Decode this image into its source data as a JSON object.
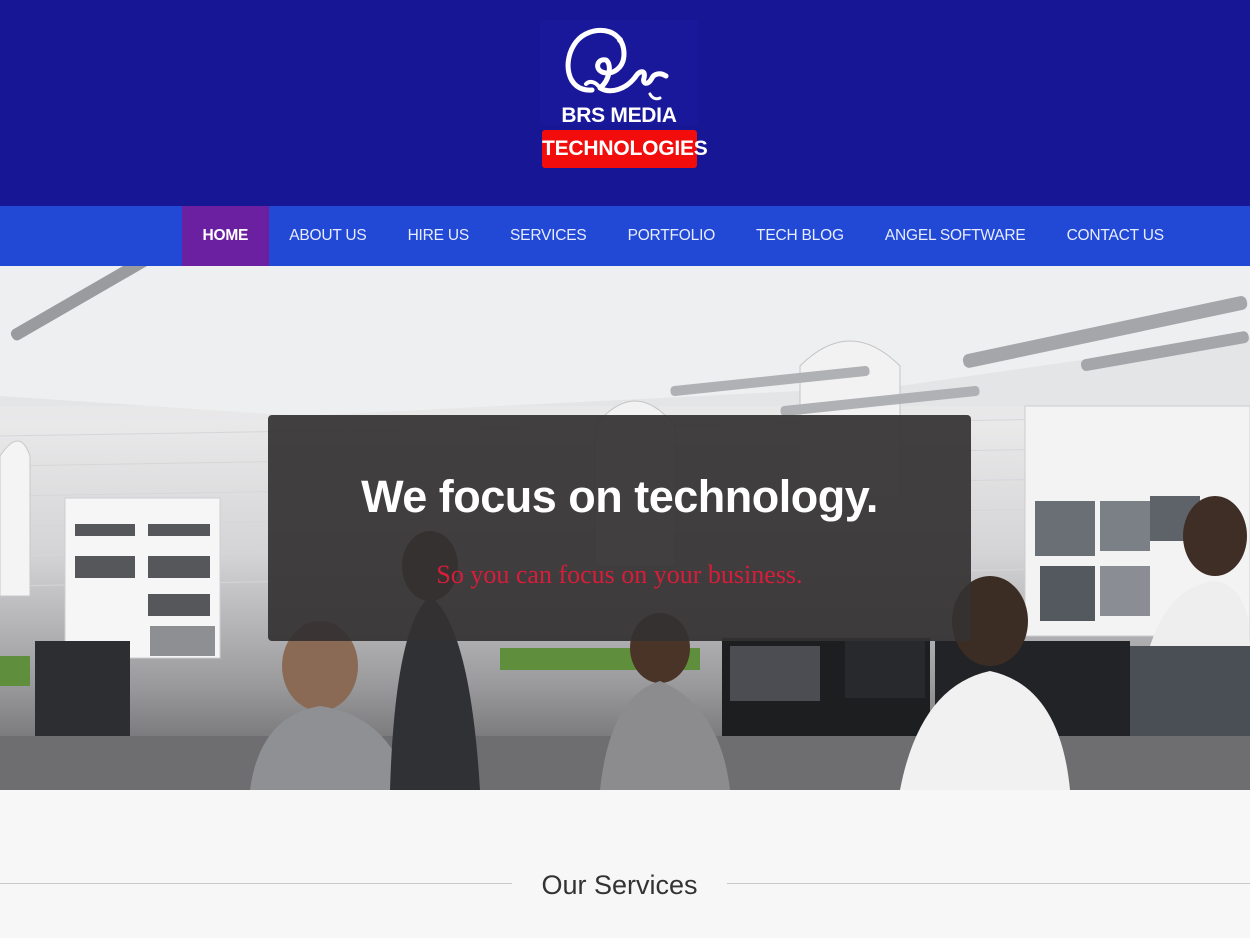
{
  "brand": {
    "name": "BRS MEDIA",
    "tagline": "TECHNOLOGIES",
    "icon": "brs-swirl-logo-icon"
  },
  "nav": {
    "items": [
      {
        "label": "HOME",
        "active": true
      },
      {
        "label": "ABOUT US",
        "active": false
      },
      {
        "label": "HIRE US",
        "active": false
      },
      {
        "label": "SERVICES",
        "active": false
      },
      {
        "label": "PORTFOLIO",
        "active": false
      },
      {
        "label": "TECH BLOG",
        "active": false
      },
      {
        "label": "ANGEL SOFTWARE",
        "active": false
      },
      {
        "label": "CONTACT US",
        "active": false
      }
    ]
  },
  "hero": {
    "title": "We focus on technology.",
    "subtitle": "So you can focus on your business."
  },
  "services": {
    "heading": "Our Services"
  },
  "colors": {
    "header_bg": "#171694",
    "nav_bg": "#2149d6",
    "nav_active_bg": "#6b1fa1",
    "tag_red": "#f20c0c",
    "subtitle_red": "#d81d3a"
  }
}
